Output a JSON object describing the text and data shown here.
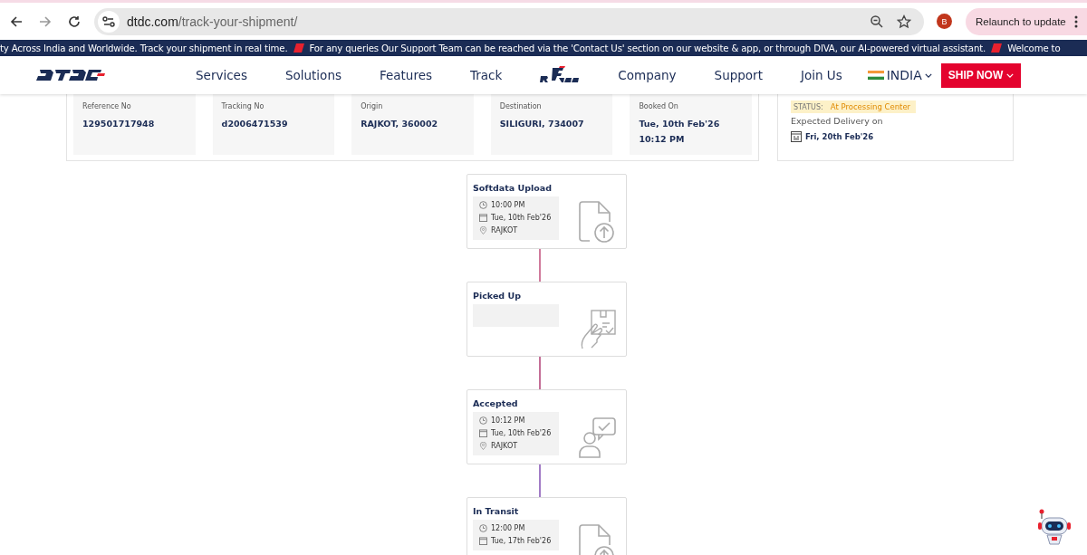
{
  "browser": {
    "url_host": "dtdc.com",
    "url_path": "/track-your-shipment/",
    "profile_initial": "B",
    "update_button": "Relaunch to update"
  },
  "ticker": [
    "ty Across India and Worldwide. Track your shipment in real time.",
    "For any queries Our Support Team can be reached via the 'Contact Us' section on our website & app, or through DIVA, our AI-powered virtual assistant.",
    "Welcome to"
  ],
  "nav": {
    "items": [
      {
        "label": "Services",
        "kind": "text"
      },
      {
        "label": "Solutions",
        "kind": "text"
      },
      {
        "label": "Features",
        "kind": "text"
      },
      {
        "label": "Track",
        "kind": "text"
      },
      {
        "kind": "logo"
      },
      {
        "label": "Company",
        "kind": "text"
      },
      {
        "label": "Support",
        "kind": "text"
      },
      {
        "label": "Join Us",
        "kind": "text"
      }
    ],
    "country": "INDIA",
    "ship_button": "SHIP NOW"
  },
  "details": [
    {
      "label": "Reference No",
      "value": "129501717948"
    },
    {
      "label": "Tracking No",
      "value": "d2006471539"
    },
    {
      "label": "Origin",
      "value": "RAJKOT, 360002"
    },
    {
      "label": "Destination",
      "value": "SILIGURI, 734007"
    },
    {
      "label": "Booked On",
      "value": "Tue, 10th Feb'26",
      "value_2": "10:12 PM"
    }
  ],
  "status": {
    "label": "STATUS:",
    "value": "At Processing Center",
    "expected_label": "Expected Delivery on",
    "expected_date": "Fri, 20th Feb'26"
  },
  "timeline": [
    {
      "title": "Softdata Upload",
      "kind": "upload",
      "time": "10:00 PM",
      "date": "Tue, 10th Feb'26",
      "place": "RAJKOT",
      "color": "#d07a9c"
    },
    {
      "title": "Picked Up",
      "kind": "hand",
      "color": "#c46f97"
    },
    {
      "title": "Accepted",
      "kind": "person",
      "time": "10:12 PM",
      "date": "Tue, 10th Feb'26",
      "place": "RAJKOT",
      "color": "#a27cc6"
    },
    {
      "title": "In Transit",
      "kind": "upload",
      "time": "12:00 PM",
      "date": "Tue, 17th Feb'26"
    }
  ]
}
